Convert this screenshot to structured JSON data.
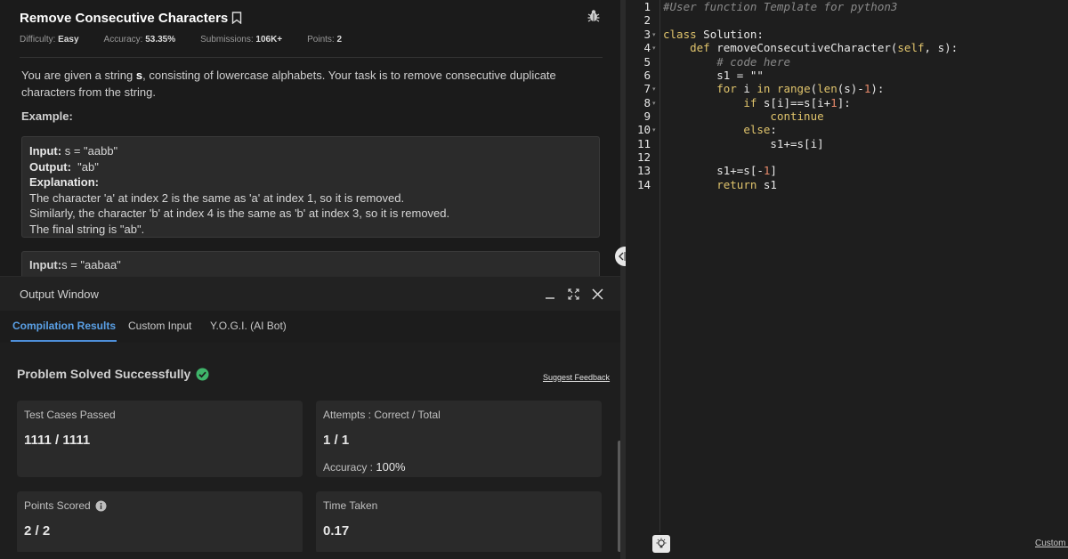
{
  "problem": {
    "title": "Remove Consecutive Characters",
    "difficulty_label": "Difficulty:",
    "difficulty": "Easy",
    "accuracy_label": "Accuracy:",
    "accuracy": "53.35%",
    "submissions_label": "Submissions:",
    "submissions": "106K+",
    "points_label": "Points:",
    "points": "2",
    "desc_pre": "You are given a string ",
    "desc_var": "s",
    "desc_post": ", consisting of lowercase alphabets. Your task is to remove consecutive duplicate characters from the string.",
    "example_label": "Example:",
    "ex1_input_label": "Input:",
    "ex1_input": " s = \"aabb\"",
    "ex1_output_label": "Output:",
    "ex1_output": "  \"ab\"",
    "ex1_expl_label": "Explanation:",
    "ex1_expl_1": "The character 'a' at index 2 is the same as 'a' at index 1, so it is removed.",
    "ex1_expl_2": "Similarly, the character 'b' at index 4 is the same as 'b' at index 3, so it is removed.",
    "ex1_expl_3": "The final string is \"ab\".",
    "ex2_input_label": "Input:",
    "ex2_input": "s = \"aabaa\""
  },
  "output": {
    "title": "Output Window",
    "tabs": [
      "Compilation Results",
      "Custom Input",
      "Y.O.G.I. (AI Bot)"
    ],
    "solved": "Problem Solved Successfully",
    "feedback": "Suggest Feedback",
    "cards": {
      "tests_label": "Test Cases Passed",
      "tests_value": "1111 / 1111",
      "attempts_label": "Attempts : Correct / Total",
      "attempts_value": "1 / 1",
      "accuracy_label": "Accuracy :",
      "accuracy_value": "100%",
      "points_label": "Points Scored",
      "points_value": "2 / 2",
      "time_label": "Time Taken",
      "time_value": "0.17"
    }
  },
  "editor": {
    "line_numbers": [
      "1",
      "2",
      "3",
      "4",
      "5",
      "6",
      "7",
      "8",
      "9",
      "10",
      "11",
      "12",
      "13",
      "14"
    ],
    "custom_input": "Custom Input"
  },
  "colors": {
    "accent_tab": "#5aa0e6",
    "success": "#3fb56a",
    "keyword": "#e0c46c",
    "number": "#e88a6b"
  }
}
